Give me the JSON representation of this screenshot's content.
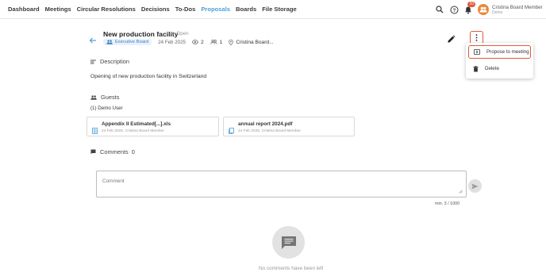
{
  "nav": {
    "items": [
      {
        "label": "Dashboard",
        "active": false
      },
      {
        "label": "Meetings",
        "active": false
      },
      {
        "label": "Circular Resolutions",
        "active": false
      },
      {
        "label": "Decisions",
        "active": false
      },
      {
        "label": "To-Dos",
        "active": false
      },
      {
        "label": "Proposals",
        "active": true
      },
      {
        "label": "Boards",
        "active": false
      },
      {
        "label": "File Storage",
        "active": false
      }
    ],
    "notification_count": "10",
    "user_name": "Cristina Board Member",
    "user_sub": "Demo"
  },
  "proposal": {
    "title": "New production facility",
    "status": "Open",
    "board_chip": "Executive Board",
    "date": "24 Feb 2025",
    "views": "2",
    "guests_count": "1",
    "author": "Cristina Board..."
  },
  "menu": {
    "propose_label": "Propose to meeting",
    "delete_label": "Delete"
  },
  "description": {
    "heading": "Description",
    "text": "Opening of new production facility in Switzerland"
  },
  "guests": {
    "heading": "Guests",
    "text": "(1) Demo User"
  },
  "files": [
    {
      "name": "Appendix II Estimated[...].xls",
      "meta": "24 Feb 2025, Cristina Board Member"
    },
    {
      "name": "annual report 2024.pdf",
      "meta": "24 Feb 2025, Cristina Board Member"
    }
  ],
  "comments": {
    "heading": "Comments",
    "count": "0",
    "placeholder": "Comment",
    "counter": "min. 3 / 1000",
    "empty_text": "No comments have been left"
  },
  "colors": {
    "accent": "#4a9fd8",
    "highlight": "#e05a3a",
    "avatar": "#e8893a"
  }
}
